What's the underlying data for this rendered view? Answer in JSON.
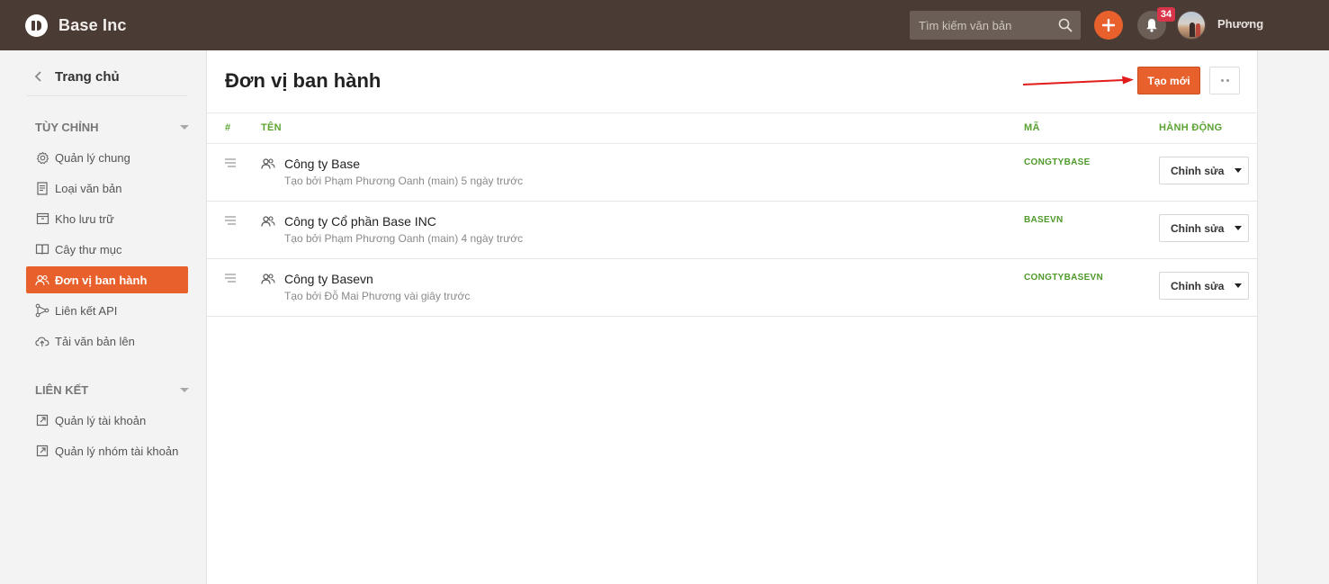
{
  "header": {
    "brand": "Base Inc",
    "search_placeholder": "Tìm kiếm văn bản",
    "notification_count": "34",
    "user_name": "Phương"
  },
  "sidebar": {
    "back_label": "Trang chủ",
    "sections": [
      {
        "title": "TÙY CHỈNH",
        "items": [
          {
            "label": "Quản lý chung",
            "icon": "gear-icon"
          },
          {
            "label": "Loại văn bản",
            "icon": "document-icon"
          },
          {
            "label": "Kho lưu trữ",
            "icon": "archive-icon"
          },
          {
            "label": "Cây thư mục",
            "icon": "book-icon"
          },
          {
            "label": "Đơn vị ban hành",
            "icon": "users-icon",
            "active": true
          },
          {
            "label": "Liên kết API",
            "icon": "api-link-icon"
          },
          {
            "label": "Tải văn bản lên",
            "icon": "cloud-upload-icon"
          }
        ]
      },
      {
        "title": "LIÊN KẾT",
        "items": [
          {
            "label": "Quản lý tài khoản",
            "icon": "external-link-icon"
          },
          {
            "label": "Quản lý nhóm tài khoản",
            "icon": "external-link-icon"
          }
        ]
      }
    ]
  },
  "main": {
    "title": "Đơn vị ban hành",
    "create_label": "Tạo mới",
    "columns": [
      "#",
      "TÊN",
      "MÃ",
      "HÀNH ĐỘNG"
    ],
    "rows": [
      {
        "name": "Công ty Base",
        "meta": "Tạo bởi Phạm Phương Oanh (main) 5 ngày trước",
        "code": "CONGTYBASE",
        "action": "Chỉnh sửa"
      },
      {
        "name": "Công ty Cổ phần Base INC",
        "meta": "Tạo bởi Phạm Phương Oanh (main) 4 ngày trước",
        "code": "BASEVN",
        "action": "Chỉnh sửa"
      },
      {
        "name": "Công ty Basevn",
        "meta": "Tạo bởi Đỗ Mai Phương vài giây trước",
        "code": "CONGTYBASEVN",
        "action": "Chỉnh sửa"
      }
    ]
  },
  "colors": {
    "header_bg": "#4a3c35",
    "accent": "#e8612c",
    "column_header": "#5aa332",
    "badge": "#d9354a"
  }
}
